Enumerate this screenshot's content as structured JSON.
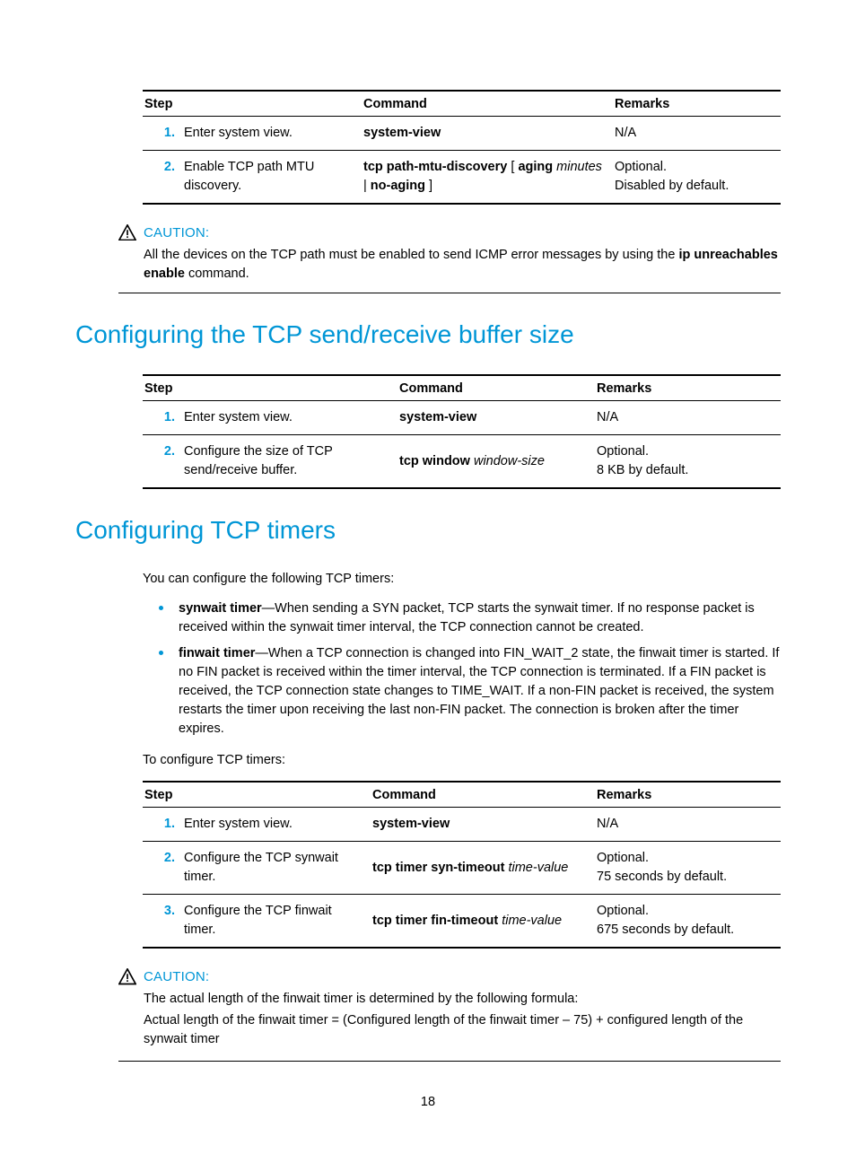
{
  "tables": {
    "mtu": {
      "headers": {
        "step": "Step",
        "command": "Command",
        "remarks": "Remarks"
      },
      "rows": [
        {
          "num": "1.",
          "step": "Enter system view.",
          "cmd_b1": "system-view",
          "remarks": "N/A"
        },
        {
          "num": "2.",
          "step": "Enable TCP path MTU discovery.",
          "cmd_b1": "tcp path-mtu-discovery",
          "cmd_p1": " [ ",
          "cmd_b2": "aging",
          "cmd_i1": " minutes",
          "cmd_p2": " | ",
          "cmd_b3": "no-aging",
          "cmd_p3": " ]",
          "remarks": "Optional.\nDisabled by default."
        }
      ]
    },
    "buffer": {
      "headers": {
        "step": "Step",
        "command": "Command",
        "remarks": "Remarks"
      },
      "rows": [
        {
          "num": "1.",
          "step": "Enter system view.",
          "cmd_b1": "system-view",
          "remarks": "N/A"
        },
        {
          "num": "2.",
          "step": "Configure the size of TCP send/receive buffer.",
          "cmd_b1": "tcp window",
          "cmd_i1": " window-size",
          "remarks": "Optional.\n8 KB by default."
        }
      ]
    },
    "timers": {
      "headers": {
        "step": "Step",
        "command": "Command",
        "remarks": "Remarks"
      },
      "rows": [
        {
          "num": "1.",
          "step": "Enter system view.",
          "cmd_b1": "system-view",
          "remarks": "N/A"
        },
        {
          "num": "2.",
          "step": "Configure the TCP synwait timer.",
          "cmd_b1": "tcp timer syn-timeout",
          "cmd_i1": " time-value",
          "remarks": "Optional.\n75 seconds by default."
        },
        {
          "num": "3.",
          "step": "Configure the TCP finwait timer.",
          "cmd_b1": "tcp timer fin-timeout",
          "cmd_i1": " time-value",
          "remarks": "Optional.\n675 seconds by default."
        }
      ]
    }
  },
  "caution1": {
    "label": "CAUTION:",
    "body_pre": "All the devices on the TCP path must be enabled to send ICMP error messages by using the ",
    "body_b1": "ip unreachables enable",
    "body_post": " command."
  },
  "section_buffer_title": "Configuring the TCP send/receive buffer size",
  "section_timers_title": "Configuring TCP timers",
  "timers_intro": "You can configure the following TCP timers:",
  "bullets": {
    "b1_b": "synwait timer",
    "b1_t": "—When sending a SYN packet, TCP starts the synwait timer. If no response packet is received within the synwait timer interval, the TCP connection cannot be created.",
    "b2_b": "finwait timer",
    "b2_t": "—When a TCP connection is changed into FIN_WAIT_2 state, the finwait timer is started. If no FIN packet is received within the timer interval, the TCP connection is terminated. If a FIN packet is received, the TCP connection state changes to TIME_WAIT. If a non-FIN packet is received, the system restarts the timer upon receiving the last non-FIN packet. The connection is broken after the timer expires."
  },
  "timers_toconfigure": "To configure TCP timers:",
  "caution2": {
    "label": "CAUTION:",
    "line1": "The actual length of the finwait timer is determined by the following formula:",
    "line2": "Actual length of the finwait timer = (Configured length of the finwait timer – 75) + configured length of the synwait timer"
  },
  "page_number": "18"
}
